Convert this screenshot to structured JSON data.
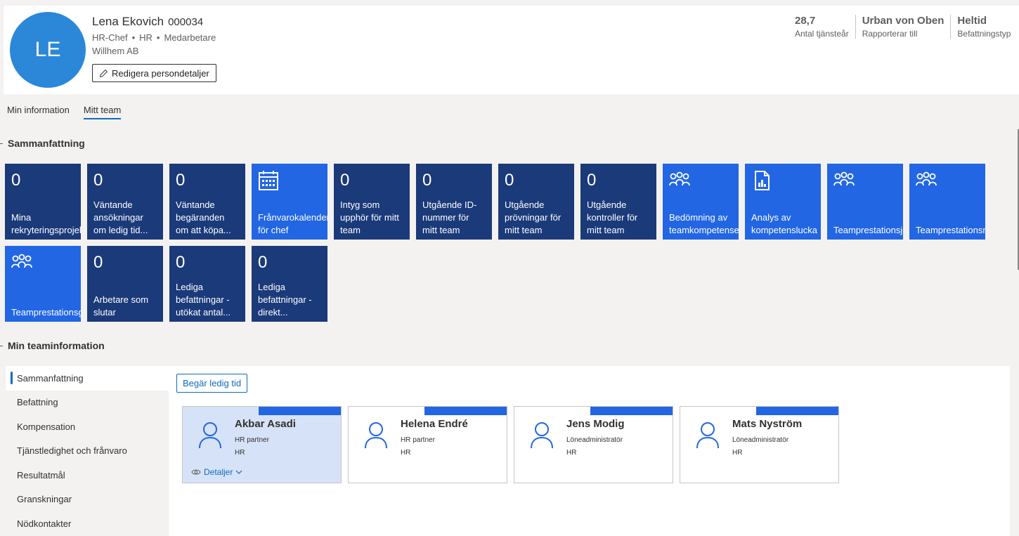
{
  "profile": {
    "initials": "LE",
    "name": "Lena Ekovich",
    "employee_id": "000034",
    "title": "HR-Chef",
    "department": "HR",
    "type": "Medarbetare",
    "company": "Willhem AB",
    "edit_label": "Redigera persondetaljer",
    "kpis": [
      {
        "value": "28,7",
        "label": "Antal tjänsteår"
      },
      {
        "value": "Urban von Oben",
        "label": "Rapporterar till"
      },
      {
        "value": "Heltid",
        "label": "Befattningstyp"
      }
    ]
  },
  "tabs": [
    {
      "label": "Min information"
    },
    {
      "label": "Mitt team"
    }
  ],
  "summary": {
    "title": "Sammanfattning",
    "tiles": [
      {
        "count": "0",
        "label": "Mina\nrekryteringsprojekt"
      },
      {
        "count": "0",
        "label": "Väntande\nansökningar\nom ledig tid..."
      },
      {
        "count": "0",
        "label": "Väntande\nbegäranden\nom att köpa..."
      },
      {
        "icon": "calendar-icon",
        "label": "Frånvarokalender\nför chef"
      },
      {
        "count": "0",
        "label": "Intyg som\nupphör för mitt\nteam"
      },
      {
        "count": "0",
        "label": "Utgående ID-\nnummer för\nmitt team"
      },
      {
        "count": "0",
        "label": "Utgående\nprövningar för\nmitt team"
      },
      {
        "count": "0",
        "label": "Utgående\nkontroller för\nmitt team"
      },
      {
        "icon": "team-icon",
        "label": "Bedömning av\nteamkompetenser"
      },
      {
        "icon": "report-icon",
        "label": "Analys av\nkompetenslucka"
      },
      {
        "icon": "team-icon",
        "label": "Teamprestationsjournal"
      },
      {
        "icon": "team-icon",
        "label": "Teamprestationsmål"
      },
      {
        "icon": "team-icon",
        "label": "Teamprestationsgranskning"
      },
      {
        "count": "0",
        "label": "Arbetare som\nslutar"
      },
      {
        "count": "0",
        "label": "Lediga\nbefattningar -\nutökat antal..."
      },
      {
        "count": "0",
        "label": "Lediga\nbefattningar -\ndirekt..."
      }
    ]
  },
  "team_info": {
    "title": "Min teaminformation",
    "nav": [
      {
        "label": "Sammanfattning"
      },
      {
        "label": "Befattning"
      },
      {
        "label": "Kompensation"
      },
      {
        "label": "Tjänstledighet och frånvaro"
      },
      {
        "label": "Resultatmål"
      },
      {
        "label": "Granskningar"
      },
      {
        "label": "Nödkontakter"
      }
    ],
    "request_leave_label": "Begär ledig tid",
    "members": [
      {
        "name": "Akbar Asadi",
        "role": "HR partner",
        "department": "HR",
        "details_label": "Detaljer"
      },
      {
        "name": "Helena Endré",
        "role": "HR partner",
        "department": "HR"
      },
      {
        "name": "Jens Modig",
        "role": "Löneadministratör",
        "department": "HR"
      },
      {
        "name": "Mats Nyström",
        "role": "Löneadministratör",
        "department": "HR"
      }
    ]
  },
  "colors": {
    "tile_dark": "#1b3a7a",
    "tile_bright": "#2266e3",
    "accent": "#0f6cbd",
    "avatar": "#2b88d8"
  }
}
